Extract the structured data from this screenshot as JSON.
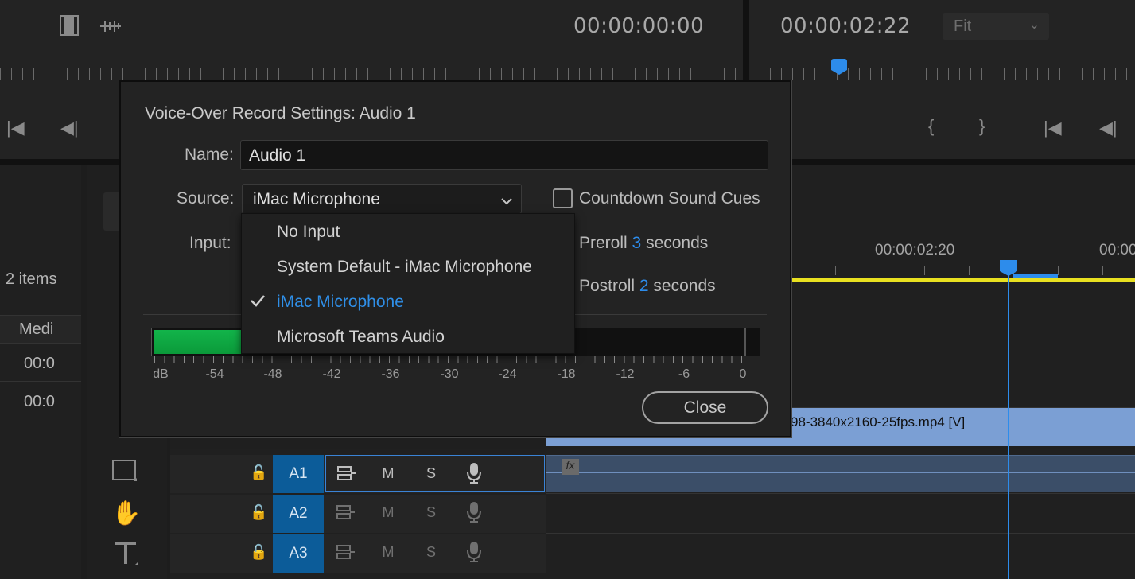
{
  "source_monitor": {
    "timecode": "00:00:00:00"
  },
  "program_monitor": {
    "timecode": "00:00:02:22",
    "zoom": "Fit"
  },
  "project_panel": {
    "item_count": "2 items",
    "column_header": "Medi",
    "rows": [
      "00:0",
      "00:0"
    ]
  },
  "timeline": {
    "ruler_labels": [
      "00:00:02:20",
      "00:00"
    ],
    "clip_label": "98-3840x2160-25fps.mp4 [V]",
    "fx_badge": "fx",
    "tracks": [
      {
        "label": "A1",
        "mute": "M",
        "solo": "S"
      },
      {
        "label": "A2",
        "mute": "M",
        "solo": "S"
      },
      {
        "label": "A3",
        "mute": "M",
        "solo": "S"
      }
    ]
  },
  "dialog": {
    "title": "Voice-Over Record Settings: Audio 1",
    "name_label": "Name:",
    "name_value": "Audio 1",
    "source_label": "Source:",
    "source_value": "iMac Microphone",
    "input_label": "Input:",
    "countdown_label": "Countdown Sound Cues",
    "countdown_checked": false,
    "preroll": {
      "prefix": "Preroll",
      "value": "3",
      "suffix": "seconds"
    },
    "postroll": {
      "prefix": "Postroll",
      "value": "2",
      "suffix": "seconds"
    },
    "meter_scale": [
      "dB",
      "-54",
      "-48",
      "-42",
      "-36",
      "-30",
      "-24",
      "-18",
      "-12",
      "-6",
      "0"
    ],
    "close_label": "Close"
  },
  "source_menu": {
    "options": [
      "No Input",
      "System Default - iMac Microphone",
      "iMac Microphone",
      "Microsoft Teams Audio"
    ],
    "selected": "iMac Microphone"
  },
  "colors": {
    "accent_blue": "#2d8ceb",
    "track_blue": "#0c5c99",
    "meter_green": "#12b44a",
    "work_area_yellow": "#e8e020"
  }
}
